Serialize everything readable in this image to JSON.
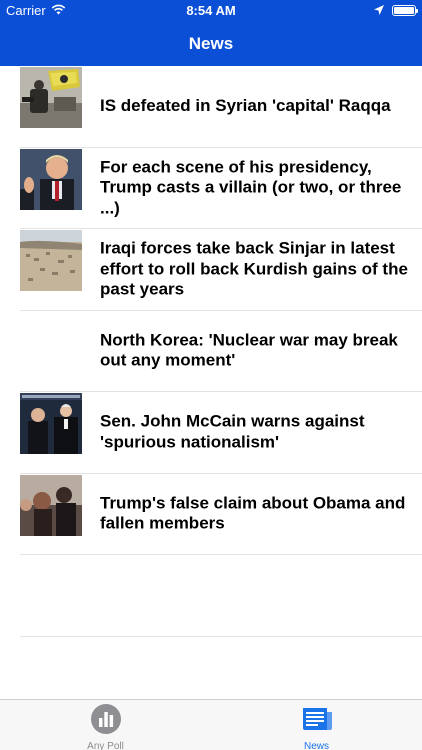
{
  "status_bar": {
    "carrier": "Carrier",
    "time": "8:54 AM",
    "icons": [
      "wifi-icon",
      "location-arrow-icon",
      "battery-icon"
    ]
  },
  "nav_bar": {
    "title": "News"
  },
  "news": {
    "items": [
      {
        "title": "IS defeated in Syrian 'capital' Raqqa",
        "thumb": "photo-soldier-flag"
      },
      {
        "title": "For each scene of his presidency, Trump casts a villain (or two, or three ...)",
        "thumb": "photo-trump-speaking"
      },
      {
        "title": "Iraqi forces take back Sinjar in latest effort to roll back Kurdish gains of the past years",
        "thumb": "photo-desert-town"
      },
      {
        "title": "North Korea: 'Nuclear war may break out any moment'",
        "thumb": ""
      },
      {
        "title": "Sen. John McCain warns against 'spurious nationalism'",
        "thumb": "photo-mccain-stage"
      },
      {
        "title": "Trump's false claim about Obama and fallen members",
        "thumb": "photo-crowd-people"
      }
    ]
  },
  "tab_bar": {
    "tabs": [
      {
        "label": "Any Poll",
        "icon": "poll-chart-icon",
        "active": false
      },
      {
        "label": "News",
        "icon": "newspaper-icon",
        "active": true
      }
    ]
  },
  "colors": {
    "header_blue": "#0a4fd6",
    "active_tab": "#1a73e8",
    "inactive_tab": "#8e8e93"
  }
}
